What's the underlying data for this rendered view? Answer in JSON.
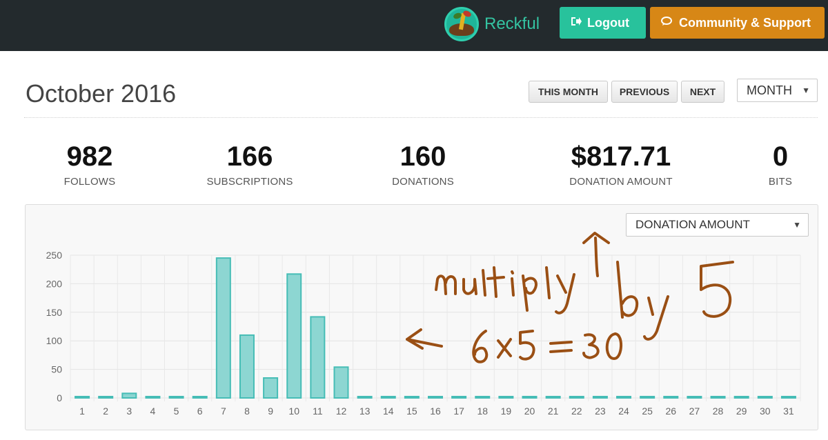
{
  "header": {
    "username": "Reckful",
    "logout_label": "Logout",
    "support_label": "Community & Support"
  },
  "period": {
    "title": "October 2016",
    "this_month_label": "THIS MONTH",
    "previous_label": "PREVIOUS",
    "next_label": "NEXT",
    "range_select": "MONTH"
  },
  "stats": [
    {
      "value": "982",
      "label": "FOLLOWS"
    },
    {
      "value": "166",
      "label": "SUBSCRIPTIONS"
    },
    {
      "value": "160",
      "label": "DONATIONS"
    },
    {
      "value": "$817.71",
      "label": "DONATION AMOUNT"
    },
    {
      "value": "0",
      "label": "BITS"
    }
  ],
  "metric_select": "DONATION AMOUNT",
  "chart_data": {
    "type": "bar",
    "categories": [
      "1",
      "2",
      "3",
      "4",
      "5",
      "6",
      "7",
      "8",
      "9",
      "10",
      "11",
      "12",
      "13",
      "14",
      "15",
      "16",
      "17",
      "18",
      "19",
      "20",
      "21",
      "22",
      "23",
      "24",
      "25",
      "26",
      "27",
      "28",
      "29",
      "30",
      "31"
    ],
    "values": [
      0,
      0,
      8,
      0,
      0,
      0,
      245,
      110,
      35,
      217,
      142,
      54,
      0,
      0,
      0,
      0,
      0,
      0,
      0,
      0,
      0,
      0,
      0,
      0,
      0,
      0,
      0,
      0,
      0,
      0,
      0
    ],
    "yticks": [
      "0",
      "50",
      "100",
      "150",
      "200",
      "250"
    ],
    "ylim": [
      0,
      250
    ],
    "grid": true,
    "bar_color": "#8dd6d2",
    "bar_border": "#46bdb6"
  },
  "annotation": {
    "line1": "multiply by 5",
    "line2": "6x5=30",
    "color": "#9a4f14"
  },
  "icons": {
    "logout": "sign-out-icon",
    "support": "comments-icon",
    "dropdown": "caret-down-icon"
  }
}
